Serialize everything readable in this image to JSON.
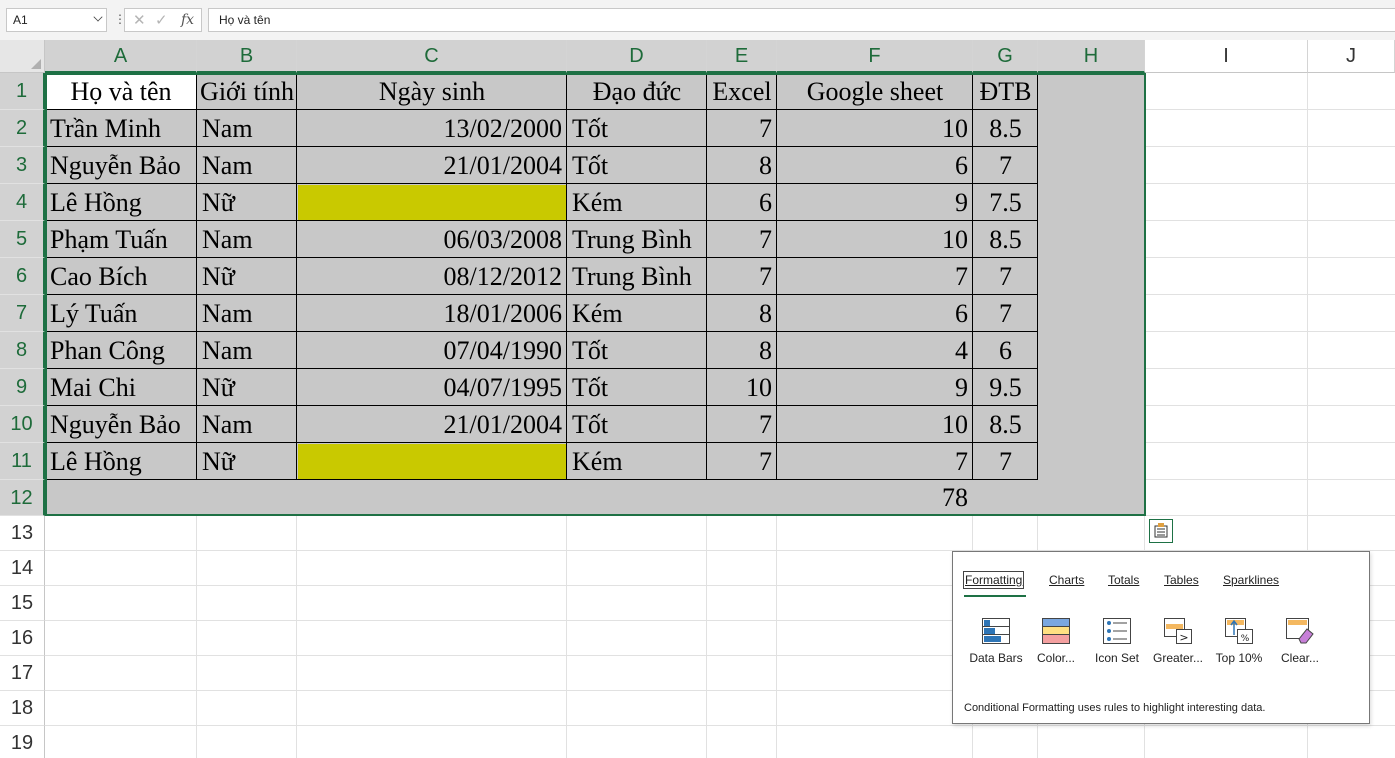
{
  "formula_bar": {
    "name_box": "A1",
    "content": "Họ và tên"
  },
  "columns": [
    "A",
    "B",
    "C",
    "D",
    "E",
    "F",
    "G",
    "H",
    "I",
    "J"
  ],
  "rows": [
    "1",
    "2",
    "3",
    "4",
    "5",
    "6",
    "7",
    "8",
    "9",
    "10",
    "11",
    "12",
    "13",
    "14",
    "15",
    "16",
    "17",
    "18",
    "19"
  ],
  "table": {
    "headers": [
      "Họ và tên",
      "Giới tính",
      "Ngày sinh",
      "Đạo đức",
      "Excel",
      "Google sheet",
      "ĐTB"
    ],
    "rows": [
      [
        "Trần Minh",
        "Nam",
        "13/02/2000",
        "Tốt",
        "7",
        "10",
        "8.5"
      ],
      [
        "Nguyễn Bảo",
        "Nam",
        "21/01/2004",
        "Tốt",
        "8",
        "6",
        "7"
      ],
      [
        "Lê Hồng",
        "Nữ",
        "",
        "Kém",
        "6",
        "9",
        "7.5"
      ],
      [
        "Phạm Tuấn",
        "Nam",
        "06/03/2008",
        "Trung Bình",
        "7",
        "10",
        "8.5"
      ],
      [
        "Cao Bích",
        "Nữ",
        "08/12/2012",
        "Trung Bình",
        "7",
        "7",
        "7"
      ],
      [
        "Lý Tuấn",
        "Nam",
        "18/01/2006",
        "Kém",
        "8",
        "6",
        "7"
      ],
      [
        "Phan Công",
        "Nam",
        "07/04/1990",
        "Tốt",
        "8",
        "4",
        "6"
      ],
      [
        "Mai Chi",
        "Nữ",
        "04/07/1995",
        "Tốt",
        "10",
        "9",
        "9.5"
      ],
      [
        "Nguyễn Bảo",
        "Nam",
        "21/01/2004",
        "Tốt",
        "7",
        "10",
        "8.5"
      ],
      [
        "Lê Hồng",
        "Nữ",
        "",
        "Kém",
        "7",
        "7",
        "7"
      ]
    ],
    "total_row": [
      "",
      "",
      "",
      "",
      "",
      "78",
      ""
    ]
  },
  "colors": {
    "selection_fill": "#c8c8c8",
    "highlight_fill": "#c9c900",
    "accent": "#1e7145"
  },
  "quick_analysis": {
    "tabs": [
      "Formatting",
      "Charts",
      "Totals",
      "Tables",
      "Sparklines"
    ],
    "active_tab": "Formatting",
    "items": [
      "Data Bars",
      "Color...",
      "Icon Set",
      "Greater...",
      "Top 10%",
      "Clear..."
    ],
    "description": "Conditional Formatting uses rules to highlight interesting data.",
    "icons": [
      "data-bars-icon",
      "color-scale-icon",
      "icon-set-icon",
      "greater-than-icon",
      "top-10-icon",
      "clear-format-icon"
    ]
  }
}
